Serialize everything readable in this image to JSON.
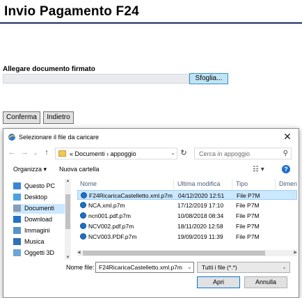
{
  "page": {
    "title": "Invio Pagamento F24",
    "attach_label": "Allegare documento firmato",
    "browse_label": "Sfoglia...",
    "confirm_label": "Conferma",
    "back_label": "Indietro"
  },
  "dialog": {
    "title": "Selezionare il file da caricare",
    "close_glyph": "✕",
    "nav": {
      "back_glyph": "←",
      "forward_glyph": "→",
      "up_glyph": "↑",
      "address_prefix": "«",
      "path": [
        "Documenti",
        "appoggio"
      ],
      "path_separator": "›",
      "search_placeholder": "Cerca in appoggio"
    },
    "toolbar": {
      "organize_label": "Organizza ▾",
      "new_folder_label": "Nuova cartella"
    },
    "sidebar": {
      "items": [
        {
          "label": "Questo PC",
          "icon": "computer-icon",
          "color": "#3a86d6"
        },
        {
          "label": "Desktop",
          "icon": "desktop-icon",
          "color": "#4aa3e0"
        },
        {
          "label": "Documenti",
          "icon": "documents-icon",
          "color": "#8a9db5",
          "selected": true
        },
        {
          "label": "Download",
          "icon": "download-icon",
          "color": "#2273c9"
        },
        {
          "label": "Immagini",
          "icon": "images-icon",
          "color": "#5a93c7"
        },
        {
          "label": "Musica",
          "icon": "music-icon",
          "color": "#2f6fb8"
        },
        {
          "label": "Oggetti 3D",
          "icon": "objects-3d-icon",
          "color": "#6aa6d8"
        }
      ]
    },
    "columns": [
      "Nome",
      "Ultima modifica",
      "Tipo",
      "Dimen"
    ],
    "files": [
      {
        "name": "F24RicaricaCastelletto.xml.p7m",
        "modified": "04/12/2020 12:51",
        "type": "File P7M",
        "selected": true
      },
      {
        "name": "NCA.xml.p7m",
        "modified": "17/12/2019 17:10",
        "type": "File P7M"
      },
      {
        "name": "ncn001.pdf.p7m",
        "modified": "10/08/2018 08:34",
        "type": "File P7M"
      },
      {
        "name": "NCV002.pdf.p7m",
        "modified": "18/11/2020 12:58",
        "type": "File P7M"
      },
      {
        "name": "NCV003.PDF.p7m",
        "modified": "19/09/2019 11:39",
        "type": "File P7M"
      }
    ],
    "filename_label": "Nome file:",
    "filename_value": "F24RicaricaCastelletto.xml.p7m",
    "filter_value": "Tutti i file (*.*)",
    "open_label": "Apri",
    "cancel_label": "Annulla"
  },
  "colors": {
    "title_rule": "#1a2a5e",
    "browse_bg": "#bfe4f5",
    "selection": "#cce8ff",
    "accent": "#0078d7"
  }
}
